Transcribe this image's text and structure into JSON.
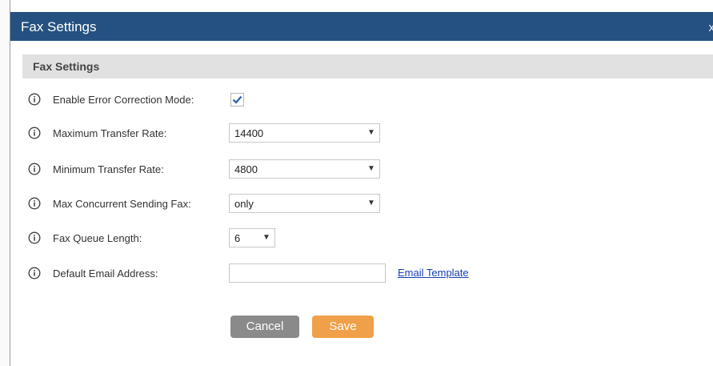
{
  "dialog": {
    "title": "Fax Settings",
    "close_label": "x",
    "section_title": "Fax Settings"
  },
  "fields": {
    "error_correction": {
      "label": "Enable Error Correction Mode:",
      "checked": true
    },
    "max_transfer_rate": {
      "label": "Maximum Transfer Rate:",
      "value": "14400"
    },
    "min_transfer_rate": {
      "label": "Minimum Transfer Rate:",
      "value": "4800"
    },
    "max_concurrent": {
      "label": "Max Concurrent Sending Fax:",
      "value": "only"
    },
    "queue_length": {
      "label": "Fax Queue Length:",
      "value": "6"
    },
    "email": {
      "label": "Default Email Address:",
      "value": "",
      "link": "Email Template"
    }
  },
  "buttons": {
    "cancel": "Cancel",
    "save": "Save"
  },
  "icons": {
    "info": "info-circle-icon",
    "check": "checkmark-icon",
    "dropdown": "triangle-down-icon"
  },
  "colors": {
    "titlebar": "#245180",
    "section_header": "#e1e1e1",
    "save_button": "#f0a048",
    "cancel_button": "#8a8a8a",
    "link": "#1a3fb5",
    "checkmark": "#2a5fa8"
  }
}
